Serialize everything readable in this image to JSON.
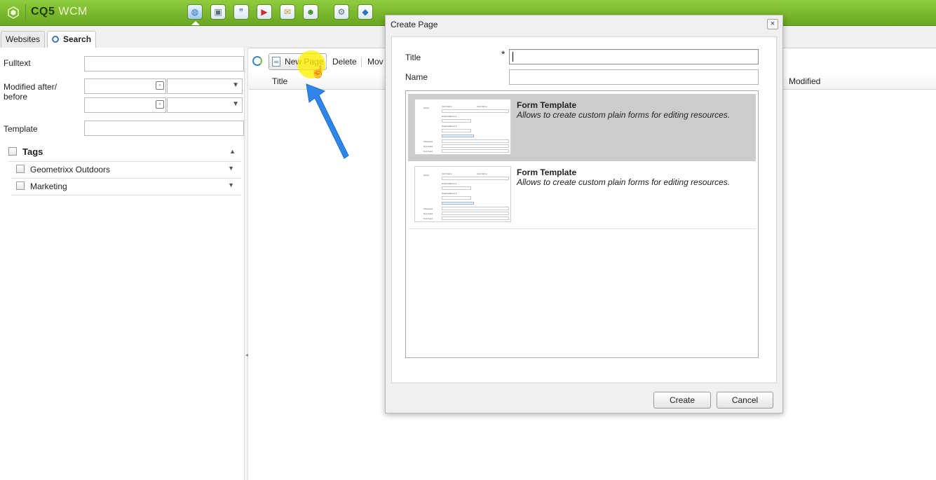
{
  "app": {
    "brand": "CQ5",
    "brand_suffix": "WCM",
    "icons": [
      "websites-icon",
      "digital-assets-icon",
      "community-icon",
      "campaigns-icon",
      "inbox-icon",
      "users-icon",
      "tools-icon",
      "tagging-icon"
    ]
  },
  "tabs": [
    {
      "label": "Websites"
    },
    {
      "label": "Search"
    }
  ],
  "search": {
    "fulltext_label": "Fulltext",
    "modified_label_1": "Modified after/",
    "modified_label_2": "before",
    "template_label": "Template",
    "tags_label": "Tags",
    "tags": [
      {
        "label": "Geometrixx Outdoors"
      },
      {
        "label": "Marketing"
      }
    ]
  },
  "toolbar": {
    "new_page": "New Page",
    "delete": "Delete",
    "move": "Mov"
  },
  "grid": {
    "col_title": "Title",
    "col_modified": "Modified"
  },
  "dialog": {
    "title": "Create Page",
    "close": "×",
    "title_label": "Title",
    "required_mark": "*",
    "name_label": "Name",
    "title_value": "",
    "name_value": "",
    "templates": [
      {
        "title": "Form Template",
        "description": "Allows to create custom plain forms for editing resources.",
        "selected": true
      },
      {
        "title": "Form Template",
        "description": "Allows to create custom plain forms for editing resources.",
        "selected": false
      }
    ],
    "create_button": "Create",
    "cancel_button": "Cancel"
  },
  "colors": {
    "topbar": "#7ab82e",
    "selected_template": "#cccccc",
    "highlight": "#fff000",
    "arrow": "#2f86e8"
  }
}
